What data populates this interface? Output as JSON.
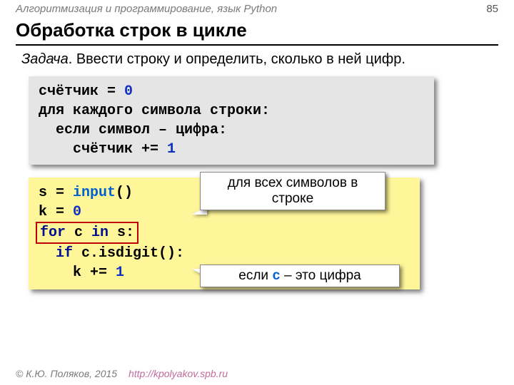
{
  "header": {
    "breadcrumb": "Алгоритмизация и программирование, язык Python",
    "page_number": "85",
    "title": "Обработка строк в цикле"
  },
  "task": {
    "label": "Задача",
    "text": ". Ввести строку и определить, сколько в ней цифр."
  },
  "pseudo": {
    "l1a": "счётчик = ",
    "l1b": "0",
    "l2": "для каждого символа строки:",
    "l3": "  если символ – цифра:",
    "l4a": "    счётчик += ",
    "l4b": "1"
  },
  "code": {
    "l1": {
      "a": "s = ",
      "b": "input",
      "c": "()"
    },
    "l2": {
      "a": "k = ",
      "b": "0"
    },
    "l3": {
      "a": "for",
      "b": " c ",
      "c": "in",
      "d": " s:"
    },
    "l4": {
      "pad": "  ",
      "a": "if",
      "b": " c.isdigit():"
    },
    "l5": {
      "pad": "    ",
      "a": "k += ",
      "b": "1"
    }
  },
  "callouts": {
    "c1": "для всех символов в строке",
    "c2_before": "если ",
    "c2_code": "c",
    "c2_after": " – это цифра"
  },
  "footer": {
    "copyright": "© К.Ю. Поляков, 2015",
    "url": "http://kpolyakov.spb.ru"
  }
}
